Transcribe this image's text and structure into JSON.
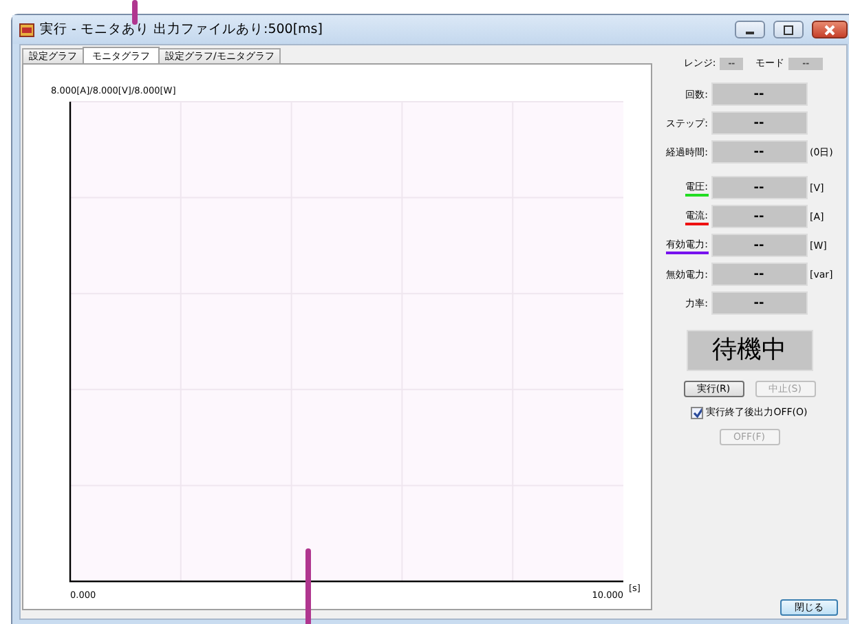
{
  "window": {
    "title": "実行 - モニタあり 出力ファイルあり:500[ms]"
  },
  "tabs": [
    {
      "label": "設定グラフ",
      "selected": false
    },
    {
      "label": "モニタグラフ",
      "selected": true
    },
    {
      "label": "設定グラフ/モニタグラフ",
      "selected": false
    }
  ],
  "graph": {
    "scale_label": "8.000[A]/8.000[V]/8.000[W]",
    "x_start": "0.000",
    "x_end": "10.000",
    "x_unit": "[s]"
  },
  "panel": {
    "range": {
      "label": "レンジ:",
      "value": "--"
    },
    "mode": {
      "label": "モード",
      "value": "--"
    },
    "readouts": [
      {
        "label": "回数:",
        "value": "--"
      },
      {
        "label": "ステップ:",
        "value": "--"
      },
      {
        "label": "経過時間:",
        "value": "--",
        "unit": "(0日)"
      },
      {
        "label": "電圧:",
        "value": "--",
        "unit": "[V]",
        "color": "#22dd22"
      },
      {
        "label": "電流:",
        "value": "--",
        "unit": "[A]",
        "color": "#ee1111"
      },
      {
        "label": "有効電力:",
        "value": "--",
        "unit": "[W]",
        "color": "#7711ee"
      },
      {
        "label": "無効電力:",
        "value": "--",
        "unit": "[var]"
      },
      {
        "label": "力率:",
        "value": "--"
      }
    ],
    "status": "待機中",
    "buttons": [
      {
        "label": "実行(R)",
        "disabled": false
      },
      {
        "label": "中止(S)",
        "disabled": true
      }
    ],
    "checkbox": {
      "label": "実行終了後出力OFF(O)",
      "checked": true
    },
    "off_button": {
      "label": "OFF(F)",
      "disabled": true
    }
  },
  "close_button": "閉じる"
}
